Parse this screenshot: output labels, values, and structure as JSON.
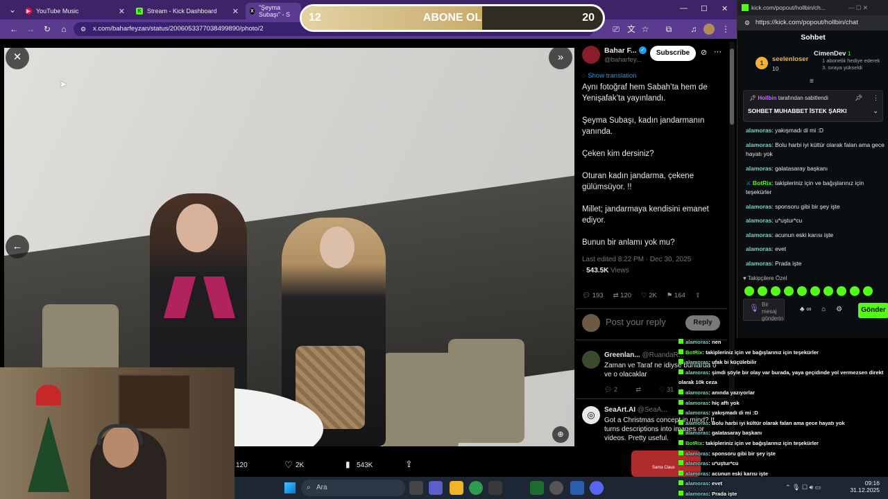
{
  "browser": {
    "tabs": [
      {
        "title": "YouTube Music",
        "icon_color": "#ff0033"
      },
      {
        "title": "Stream - Kick Dashboard",
        "icon_color": "#53fc18"
      },
      {
        "title": "\"Şeyma Subaşı\" - S",
        "icon_color": "#000000"
      }
    ],
    "url": "x.com/baharfeyzan/status/2006053377038499890/photo/2"
  },
  "goal_bar": {
    "current": "12",
    "label": "ABONE OL",
    "target": "20",
    "progress": 0.6
  },
  "tweet": {
    "author_name": "Bahar F...",
    "author_handle": "@baharfey...",
    "subscribe_label": "Subscribe",
    "translate_label": "Show translation",
    "paragraphs": [
      "Aynı fotoğraf hem Sabah’ta hem de Yenişafak’ta yayınlandı.",
      "Şeyma Subaşı, kadın jandarmanın yanında.",
      "Çeken kim dersiniz?",
      "Oturan kadın jandarma, çekene gülümsüyor. !!",
      "Millet; jandarmaya kendisini emanet ediyor.",
      "Bunun bir anlamı yok mu?"
    ],
    "edited": "Last edited 8:22 PM · Dec 30, 2025",
    "views_count": "543.5K",
    "views_label": "Views",
    "replies": "193",
    "reposts": "120",
    "likes": "2K",
    "bookmarks": "164",
    "reply_placeholder": "Post your reply",
    "reply_button": "Reply"
  },
  "replies": [
    {
      "name": "Greenlan...",
      "handle": "@RuandaR...",
      "text": "Zaman ve Taraf ne idiyse bunlarda o ve o olacaklar",
      "replies": "2",
      "likes": "31"
    },
    {
      "name": "SeaArt.AI",
      "handle": "@SeaA...",
      "text": "Got a Christmas concept in mind? It turns descriptions into images or videos. Pretty useful.",
      "thumb_label": "Santa Claus"
    }
  ],
  "media_stats": {
    "reposts": "120",
    "likes": "2K",
    "views": "543K"
  },
  "taskbar": {
    "search_label": "Ara",
    "time": "09:16",
    "date": "31.12.2025"
  },
  "chat": {
    "window_title": "kick.com/popout/hollbin/ch...",
    "url": "https://kick.com/popout/hollbin/chat",
    "heading": "Sohbet",
    "gifter": {
      "name": "seelenloser",
      "count": "10"
    },
    "gift_event": {
      "name": "CimenDev",
      "badge": "1",
      "text": "1 abonelik hediye ederek 3. sıraya yükseldi"
    },
    "pinned": {
      "by": "Hollbin",
      "by_suffix": "tarafından sabitlendi",
      "text": "SOHBET MUHABBET İSTEK ŞARKI"
    },
    "messages": [
      {
        "user": "alamoras",
        "text": ": yakışmadı di mi :D"
      },
      {
        "user": "alamoras",
        "text": ": Bolu harbi iyi kültür olarak falan ama gece hayatı yok"
      },
      {
        "user": "alamoras",
        "text": ": galatasaray başkanı"
      },
      {
        "user": "BotRix",
        "text": ": takipleriniz için ve bağışlarınız için teşekürler"
      },
      {
        "user": "alamoras",
        "text": ": sponsoru gibi bir şey işte"
      },
      {
        "user": "alamoras",
        "text": ": u*uştur*cu"
      },
      {
        "user": "alamoras",
        "text": ": acunun eski karısı işte"
      },
      {
        "user": "alamoras",
        "text": ": evet"
      },
      {
        "user": "alamoras",
        "text": ": Prada işte"
      }
    ],
    "emote_label": "Takipçilere Özel",
    "input_placeholder": "Bir mesaj gönderin",
    "send_label": "Gönder"
  },
  "overlay_chat": [
    {
      "user": "alamoras",
      "text": ": nen"
    },
    {
      "user": "BotRix",
      "text": ": takipleriniz için ve bağışlarınız için teşekürler"
    },
    {
      "user": "alamoras",
      "text": ": ufak bi küçülebilir"
    },
    {
      "user": "alamoras",
      "text": ": şimdi şöyle bir olay var burada, yaya geçidinde yol vermezsen direkt"
    },
    {
      "user": "",
      "text": "olarak 10k ceza"
    },
    {
      "user": "alamoras",
      "text": ": anında yazıyorlar"
    },
    {
      "user": "alamoras",
      "text": ": hiç affı yok"
    },
    {
      "user": "alamoras",
      "text": ": yakışmadı di mi :D"
    },
    {
      "user": "alamoras",
      "text": ": Bolu harbi iyi kültür olarak falan ama gece hayatı yok"
    },
    {
      "user": "alamoras",
      "text": ": galatasaray başkanı"
    },
    {
      "user": "BotRix",
      "text": ": takipleriniz için ve bağışlarınız için teşekürler"
    },
    {
      "user": "alamoras",
      "text": ": sponsoru gibi bir şey işte"
    },
    {
      "user": "alamoras",
      "text": ": u*uştur*cu"
    },
    {
      "user": "alamoras",
      "text": ": acunun eski karısı işte"
    },
    {
      "user": "alamoras",
      "text": ": evet"
    },
    {
      "user": "alamoras",
      "text": ": Prada işte"
    }
  ],
  "colors": {
    "kick_green": "#53fc18",
    "browser_purple": "#5a3b90",
    "x_blue": "#1d9bf0"
  }
}
